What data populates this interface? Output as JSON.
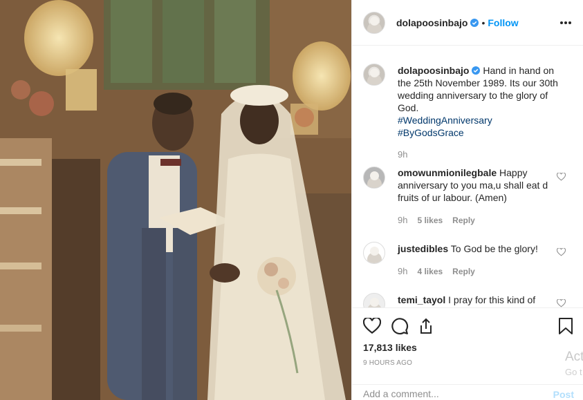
{
  "post": {
    "author": "dolapoosinbajo",
    "follow_label": "Follow",
    "dot": "•",
    "caption_text": "Hand in hand on the 25th November 1989. Its our 30th wedding anniversary to the glory of God.",
    "hashtags": [
      "#WeddingAnniversary",
      "#ByGodsGrace"
    ],
    "caption_time": "9h"
  },
  "comments": [
    {
      "user": "omowunmionilegbale",
      "text": "Happy anniversary to you ma,u shall eat d fruits of ur labour. (Amen)",
      "time": "9h",
      "likes": "5 likes",
      "reply": "Reply"
    },
    {
      "user": "justedibles",
      "text": "To God be the glory!",
      "time": "9h",
      "likes": "4 likes",
      "reply": "Reply"
    },
    {
      "user": "temi_tayol",
      "text": "I pray for this kind of",
      "time": "",
      "likes": "",
      "reply": ""
    }
  ],
  "stats": {
    "likes": "17,813 likes",
    "posted": "9 HOURS AGO"
  },
  "composer": {
    "placeholder": "Add a comment...",
    "post_label": "Post"
  },
  "watermark": {
    "line1": "Act",
    "line2": "Go t"
  },
  "colors": {
    "link": "#0095f6",
    "hashtag": "#00376b",
    "muted": "#8e8e8e",
    "verified": "#3897f0"
  },
  "icons": [
    "verified-badge-icon",
    "more-options-icon",
    "heart-icon",
    "comment-icon",
    "share-icon",
    "bookmark-icon",
    "small-heart-icon"
  ]
}
